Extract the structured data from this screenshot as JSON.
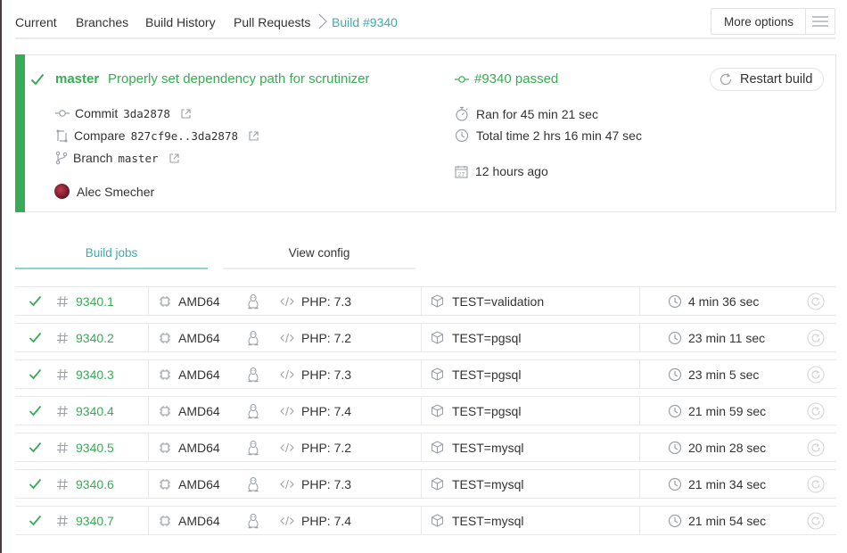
{
  "nav": {
    "tabs": [
      {
        "label": "Current"
      },
      {
        "label": "Branches"
      },
      {
        "label": "Build History"
      },
      {
        "label": "Pull Requests"
      },
      {
        "label": "Build #9340"
      }
    ],
    "more_options": "More options"
  },
  "build": {
    "branch": "master",
    "message": "Properly set dependency path for scrutinizer",
    "status": "#9340 passed",
    "restart_label": "Restart build",
    "commit_label": "Commit",
    "commit_sha": "3da2878",
    "compare_label": "Compare",
    "compare_range": "827cf9e..3da2878",
    "branch_label": "Branch",
    "branch_value": "master",
    "author": "Alec Smecher",
    "ran_for": "Ran for 45 min 21 sec",
    "total_time": "Total time 2 hrs 16 min 47 sec",
    "finished": "12 hours ago",
    "status_color": "#39aa56"
  },
  "job_tabs": {
    "build_jobs": "Build jobs",
    "view_config": "View config"
  },
  "jobs": [
    {
      "number": "9340.1",
      "arch": "AMD64",
      "lang": "PHP: 7.3",
      "env": "TEST=validation",
      "duration": "4 min 36 sec"
    },
    {
      "number": "9340.2",
      "arch": "AMD64",
      "lang": "PHP: 7.2",
      "env": "TEST=pgsql",
      "duration": "23 min 11 sec"
    },
    {
      "number": "9340.3",
      "arch": "AMD64",
      "lang": "PHP: 7.3",
      "env": "TEST=pgsql",
      "duration": "23 min 5 sec"
    },
    {
      "number": "9340.4",
      "arch": "AMD64",
      "lang": "PHP: 7.4",
      "env": "TEST=pgsql",
      "duration": "21 min 59 sec"
    },
    {
      "number": "9340.5",
      "arch": "AMD64",
      "lang": "PHP: 7.2",
      "env": "TEST=mysql",
      "duration": "20 min 28 sec"
    },
    {
      "number": "9340.6",
      "arch": "AMD64",
      "lang": "PHP: 7.3",
      "env": "TEST=mysql",
      "duration": "21 min 34 sec"
    },
    {
      "number": "9340.7",
      "arch": "AMD64",
      "lang": "PHP: 7.4",
      "env": "TEST=mysql",
      "duration": "21 min 54 sec"
    }
  ]
}
